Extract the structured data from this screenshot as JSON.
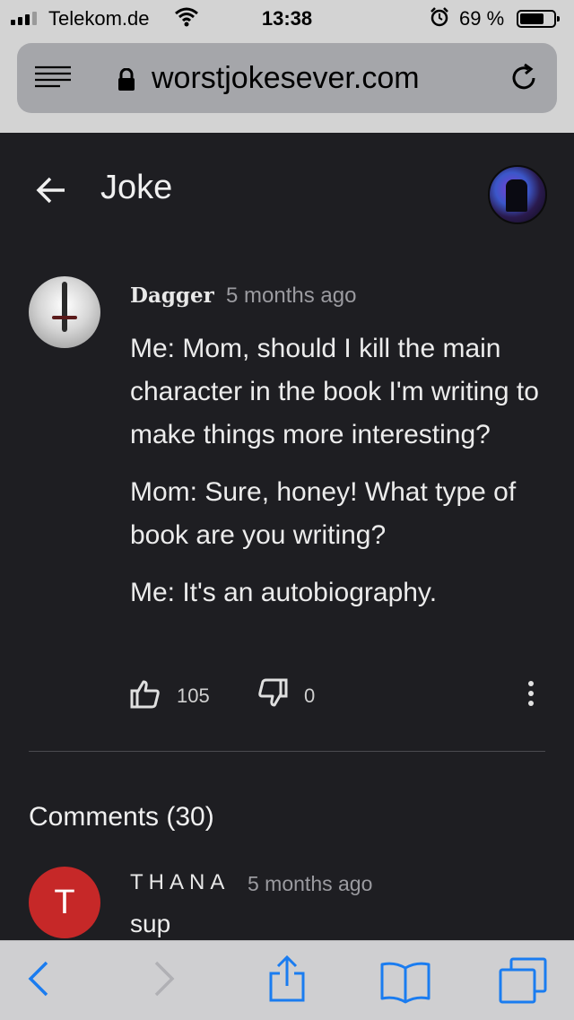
{
  "status_bar": {
    "carrier": "Telekom.de",
    "time": "13:38",
    "battery": "69 %",
    "battery_level": 0.69
  },
  "browser": {
    "url": "worstjokesever.com"
  },
  "header": {
    "title": "Joke"
  },
  "post": {
    "author": "Dagger",
    "time": "5 months ago",
    "paragraphs": [
      "Me: Mom, should I kill the main character in the book I'm writing to make things more interesting?",
      "Mom: Sure, honey! What type of book are you writing?",
      "Me: It's an autobiography."
    ],
    "likes": "105",
    "dislikes": "0"
  },
  "comments": {
    "header": "Comments (30)",
    "items": [
      {
        "avatar_letter": "T",
        "author": "THANA",
        "time": "5 months ago",
        "text": "sup"
      }
    ]
  },
  "icons": [
    "signal-icon",
    "wifi-icon",
    "alarm-icon",
    "battery-icon",
    "menu-icon",
    "lock-icon",
    "reload-icon",
    "back-arrow-icon",
    "thumbs-up-icon",
    "thumbs-down-icon",
    "more-vertical-icon",
    "chevron-left-icon",
    "chevron-right-icon",
    "share-icon",
    "bookmarks-icon",
    "tabs-icon"
  ],
  "colors": {
    "page_bg": "#1e1e22",
    "browser_chrome": "#d3d3d3",
    "url_bar": "#a5a6aa",
    "ios_blue": "#1a7cf0",
    "comment_avatar": "#c62828"
  }
}
